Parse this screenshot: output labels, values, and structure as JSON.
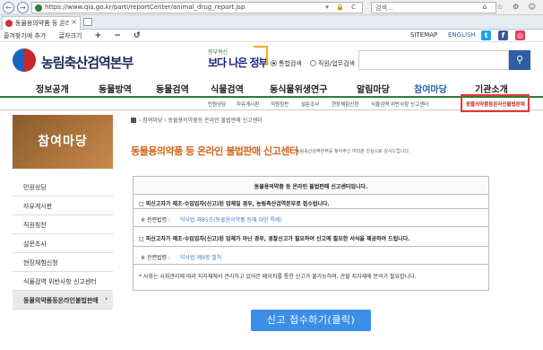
{
  "browser": {
    "url": "https://www.qia.go.kr/parti/reportCenter/animal_drug_report.jsp",
    "url_controls": "▾ 🔒 C",
    "search_placeholder": "검색...",
    "window_icons": "⌂ ☆ ⚙ ☺",
    "tab_title": "동물용의약품 등 온라인 불법"
  },
  "util": {
    "favorites": "즐겨찾기에 추가",
    "font_size": "글자크기",
    "plus": "+",
    "minus": "−",
    "reset": "↺",
    "sitemap": "SITEMAP",
    "english": "ENGLISH"
  },
  "header": {
    "logo": "농림축산검역본부",
    "gov_small": "정부혁신",
    "gov_big": "보다 나은 정부",
    "radio_all": "통합검색",
    "radio_staff": "직원/업무검색"
  },
  "gnb": [
    "정보공개",
    "동물방역",
    "동물검역",
    "식물검역",
    "동식물위생연구",
    "알림마당",
    "참여마당",
    "기관소개"
  ],
  "subnav": [
    "민원상담",
    "자유게시판",
    "직원칭찬",
    "설문조사",
    "현장체험신청",
    "식물검역 위반사항 신고센터"
  ],
  "subnav_active": "동물의약품등온라인불법판매",
  "sidebar": {
    "title": "참여마당",
    "items": [
      "민원상담",
      "자유게시판",
      "직원칭찬",
      "설문조사",
      "현장체험신청",
      "식물검역 위반사항 신고센터",
      "동물의약품등온라인불법판매"
    ],
    "active_chevron": "›"
  },
  "content": {
    "breadcrumb": "› 참여마당 › 동물용의약품등 온라인 불법판매 신고센터",
    "title": "동물용의약품 등 온라인 불법판매 신고센터",
    "subtitle": "농림축산검역본부를 찾아주신 여러분 진심으로 감사드립니다.",
    "panel_head": "동물용의약품 등 온라인 불법판매 신고센터입니다.",
    "row1": "□ 피신고자가 제조·수입업자(신고)된 업체일 경우, 농림축산검역본부로 접수됩니다.",
    "row1_label": "※ 관련법령 :",
    "row1_value": "약사법 제85조(동물용의약품 등에 대한 특례)",
    "row2": "□ 피신고자가 제조·수입업자(신고)된 업체가 아닌 경우, 경찰신고가 필요하여 신고에 필요한 서식을 제공하여 드립니다.",
    "row2_label": "※ 관련법령 :",
    "row2_value": "약사법 제9장 벌칙",
    "note": "* 사회는 사회관리에 따라 지자체에서 관리하고 있어본 페이지를 통한 신고가 불가능하며, 관할 지자체에 문의가 필요합니다.",
    "cta": "신고 접수하기(클릭)"
  },
  "colors": {
    "accent": "#2f5ea8",
    "title_orange": "#d4641c",
    "cta_blue": "#3c8ee7",
    "highlight_red": "#e53935"
  }
}
